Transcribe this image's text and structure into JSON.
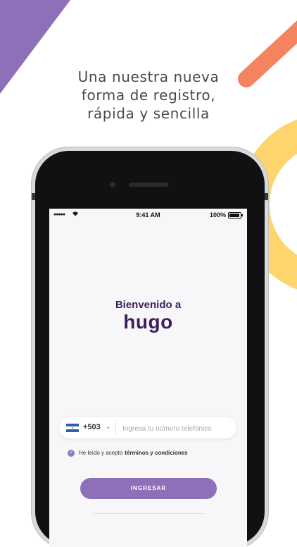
{
  "promo": {
    "line1": "Una nuestra nueva",
    "line2": "forma de registro,",
    "line3": "rápida y sencilla"
  },
  "colors": {
    "purple_accent": "#8e70b8",
    "brand_dark": "#3d1f5c",
    "orange": "#f4845f",
    "yellow": "#fdd56c"
  },
  "status_bar": {
    "time": "9:41 AM",
    "battery": "100%",
    "signal": "●●●●●"
  },
  "welcome": {
    "title": "Bienvenido a",
    "brand": "hugo"
  },
  "phone_form": {
    "country_code": "+503",
    "placeholder": "Ingresa tu número telefónico"
  },
  "terms": {
    "text": "He leído y acepto",
    "link": "términos y condiciones",
    "checked": true
  },
  "submit_label": "INGRESAR"
}
